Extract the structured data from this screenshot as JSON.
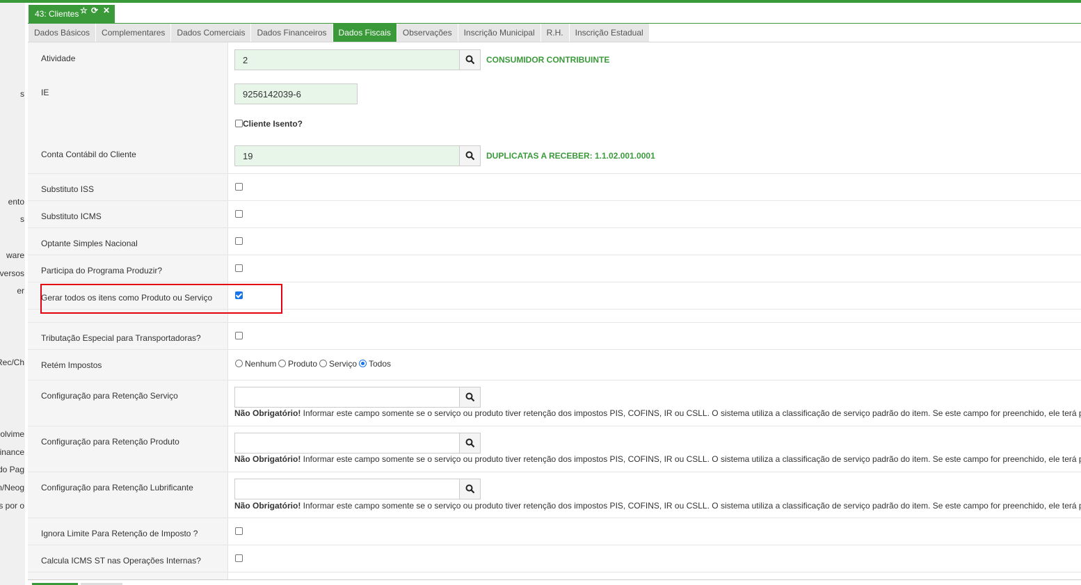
{
  "window": {
    "title": "43: Clientes",
    "icons": [
      "star-icon",
      "refresh-icon",
      "close-icon"
    ]
  },
  "sidebar_fragments": [
    "s",
    "ento",
    "s",
    "ware",
    "versos",
    "er",
    "Rec/Ch",
    "olvime",
    "inance",
    "do Pag",
    "n/Neog",
    "s por o"
  ],
  "tabs": [
    {
      "label": "Dados Básicos",
      "active": false
    },
    {
      "label": "Complementares",
      "active": false
    },
    {
      "label": "Dados Comerciais",
      "active": false
    },
    {
      "label": "Dados Financeiros",
      "active": false
    },
    {
      "label": "Dados Fiscais",
      "active": true
    },
    {
      "label": "Observações",
      "active": false
    },
    {
      "label": "Inscrição Municipal",
      "active": false
    },
    {
      "label": "R.H.",
      "active": false
    },
    {
      "label": "Inscrição Estadual",
      "active": false
    }
  ],
  "fields": {
    "atividade": {
      "label": "Atividade",
      "value": "2",
      "description": "CONSUMIDOR CONTRIBUINTE"
    },
    "ie": {
      "label": "IE",
      "value": "9256142039-6"
    },
    "cliente_isento": {
      "label": "Cliente Isento?",
      "checked": false
    },
    "conta_contabil": {
      "label": "Conta Contábil do Cliente",
      "value": "19",
      "description": "DUPLICATAS A RECEBER: 1.1.02.001.0001"
    },
    "substituto_iss": {
      "label": "Substituto ISS",
      "checked": false
    },
    "substituto_icms": {
      "label": "Substituto ICMS",
      "checked": false
    },
    "optante_simples": {
      "label": "Optante Simples Nacional",
      "checked": false
    },
    "programa_produzir": {
      "label": "Participa do Programa Produzir?",
      "checked": false
    },
    "gerar_itens": {
      "label": "Gerar todos os itens como Produto ou Serviço",
      "checked": true
    },
    "tributacao_transportadoras": {
      "label": "Tributação Especial para Transportadoras?",
      "checked": false
    },
    "retem_impostos": {
      "label": "Retém Impostos",
      "options": [
        "Nenhum",
        "Produto",
        "Serviço",
        "Todos"
      ],
      "selected": "Todos"
    },
    "retencao_servico": {
      "label": "Configuração para Retenção Serviço",
      "value": ""
    },
    "retencao_produto": {
      "label": "Configuração para Retenção Produto",
      "value": ""
    },
    "retencao_lubrificante": {
      "label": "Configuração para Retenção Lubrificante",
      "value": ""
    },
    "ignora_limite": {
      "label": "Ignora Limite Para Retenção de Imposto ?",
      "checked": false
    },
    "calcula_icms_st": {
      "label": "Calcula ICMS ST nas Operações Internas?",
      "checked": false
    }
  },
  "note": {
    "prefix": "Não Obrigatório!",
    "text": " Informar este campo somente se o serviço ou produto tiver retenção dos impostos PIS, COFINS, IR ou CSLL. O sistema utiliza a classificação de serviço padrão do item. Se este campo for preenchido, ele terá prioridade"
  },
  "colors": {
    "accent": "#3a9a3a",
    "input_bg": "#e8f5e9",
    "highlight": "#e3000f",
    "checkbox": "#1a73e8"
  }
}
